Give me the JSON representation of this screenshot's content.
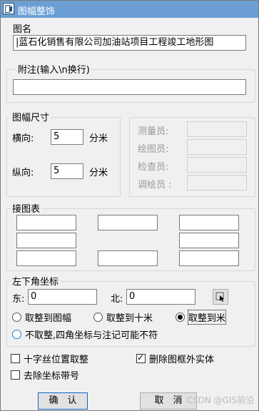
{
  "window": {
    "title": "图幅整饰"
  },
  "map_name": {
    "label": "图名",
    "value": "|蓝石化销售有限公司加油站项目工程竣工地形图"
  },
  "note": {
    "label": "附注(输入\\n换行)",
    "value": ""
  },
  "frame_size": {
    "label": "图幅尺寸",
    "horizontal_label": "横向:",
    "horizontal_value": "5",
    "vertical_label": "纵向:",
    "vertical_value": "5",
    "unit": "分米"
  },
  "staff": {
    "surveyor_label": "测量员:",
    "drafter_label": "绘图员:",
    "checker_label": "检查员:",
    "plotter_label": "调绘员 :"
  },
  "adjacent": {
    "label": "接图表"
  },
  "coords": {
    "label": "左下角坐标",
    "east_label": "东:",
    "east_value": "0",
    "north_label": "北:",
    "north_value": "0",
    "pick_icon": "pick-point-icon"
  },
  "rounding": {
    "opt1": "取整到图幅",
    "opt2": "取整到十米",
    "opt3": "取整到米",
    "opt4": "不取整,四角坐标与注记可能不符",
    "selected": "opt3"
  },
  "options": {
    "cross_label": "十字丝位置取整",
    "cross_checked": false,
    "delete_label": "删除图框外实体",
    "delete_checked": true,
    "remove_label": "去除坐标带号",
    "remove_checked": false
  },
  "buttons": {
    "ok": "确　认",
    "cancel": "取　消"
  },
  "watermark": "CSDN @GIS前沿",
  "colors": {
    "titlebar": "#6b9fd4",
    "accent": "#2a79d8"
  }
}
